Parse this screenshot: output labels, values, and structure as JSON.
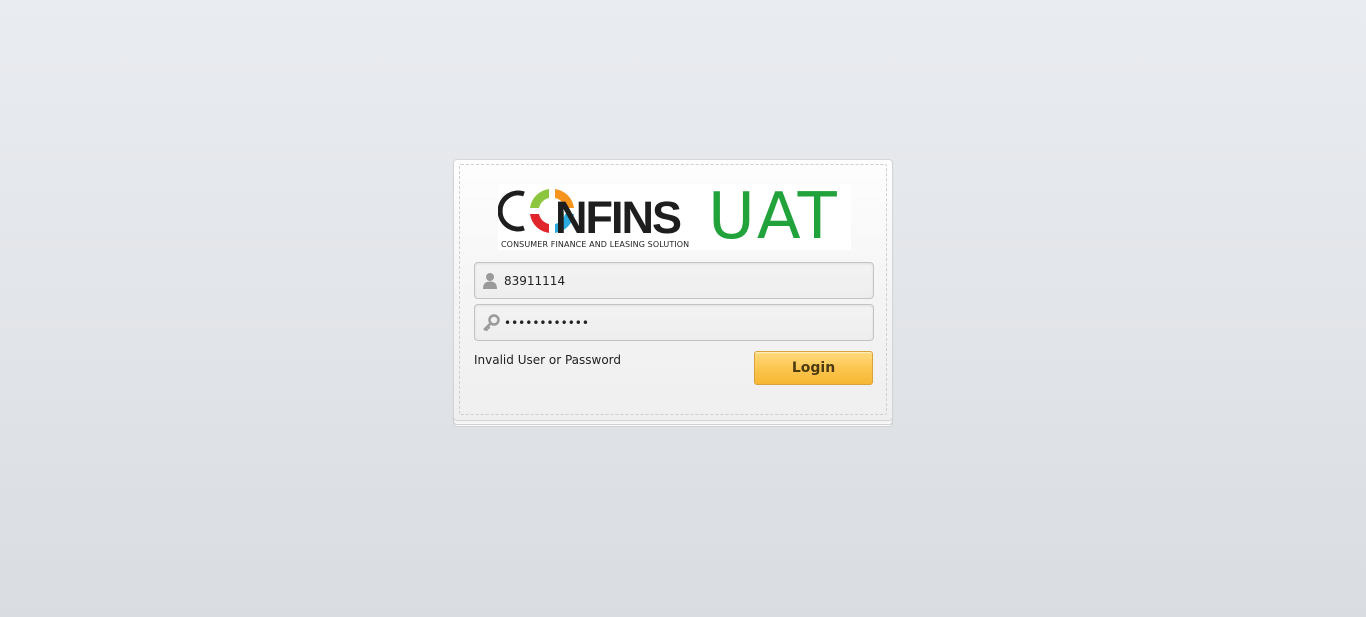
{
  "logo": {
    "brand": "CONFINS",
    "tagline": "CONSUMER FINANCE AND LEASING SOLUTION",
    "environment": "UAT",
    "colors": {
      "ring_green": "#8cc63f",
      "ring_orange": "#f7941d",
      "ring_blue": "#29abe2",
      "ring_red": "#e0262c",
      "uat": "#21a23a"
    }
  },
  "login_form": {
    "username": {
      "icon": "user-icon",
      "value": "83911114"
    },
    "password": {
      "icon": "key-icon",
      "value": "••••••••••••"
    },
    "error_message": "Invalid User or Password",
    "login_label": "Login",
    "button_color": "#fcc54d"
  }
}
